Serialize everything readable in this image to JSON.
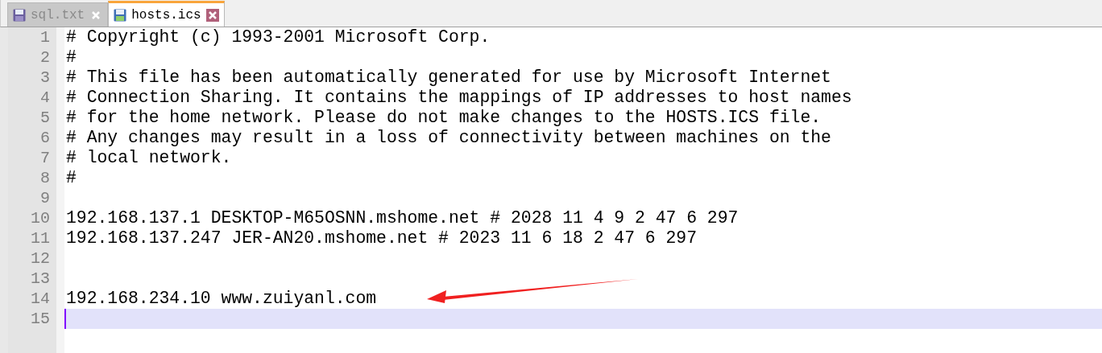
{
  "tabs": [
    {
      "label": "sql.txt",
      "selected": false
    },
    {
      "label": "hosts.ics",
      "selected": true
    }
  ],
  "editor": {
    "lines": [
      {
        "number": "1",
        "text": "# Copyright (c) 1993-2001 Microsoft Corp.",
        "current": false
      },
      {
        "number": "2",
        "text": "#",
        "current": false
      },
      {
        "number": "3",
        "text": "# This file has been automatically generated for use by Microsoft Internet",
        "current": false
      },
      {
        "number": "4",
        "text": "# Connection Sharing. It contains the mappings of IP addresses to host names",
        "current": false
      },
      {
        "number": "5",
        "text": "# for the home network. Please do not make changes to the HOSTS.ICS file.",
        "current": false
      },
      {
        "number": "6",
        "text": "# Any changes may result in a loss of connectivity between machines on the",
        "current": false
      },
      {
        "number": "7",
        "text": "# local network.",
        "current": false
      },
      {
        "number": "8",
        "text": "#",
        "current": false
      },
      {
        "number": "9",
        "current": false
      },
      {
        "number": "10",
        "text": "192.168.137.1 DESKTOP-M65OSNN.mshome.net # 2028 11 4 9 2 47 6 297",
        "current": false
      },
      {
        "number": "11",
        "text": "192.168.137.247 JER-AN20.mshome.net # 2023 11 6 18 2 47 6 297",
        "current": false
      },
      {
        "number": "12",
        "current": false
      },
      {
        "number": "13",
        "current": false
      },
      {
        "number": "14",
        "text": "192.168.234.10 www.zuiyanl.com",
        "current": false
      },
      {
        "number": "15",
        "current": true
      }
    ]
  }
}
